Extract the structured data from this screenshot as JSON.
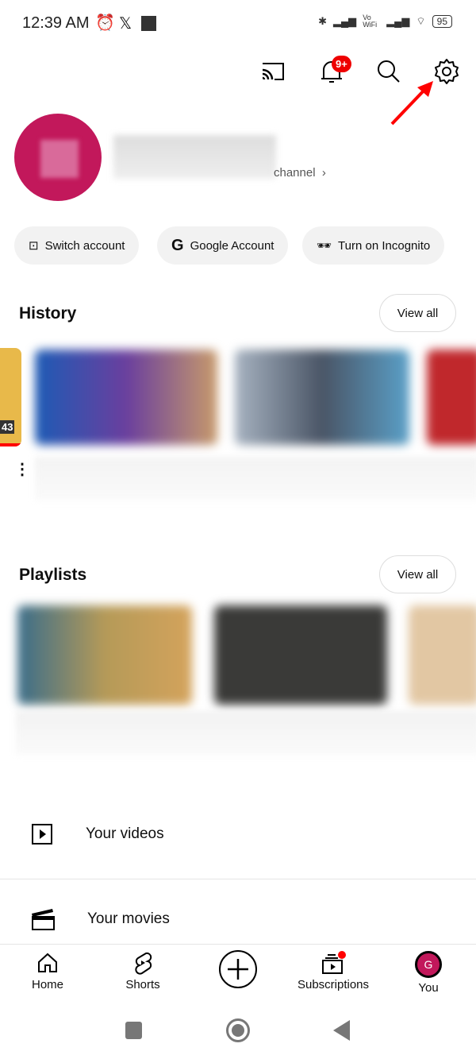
{
  "status_bar": {
    "time": "12:39 AM",
    "battery": "95",
    "network": "Vo WiFi"
  },
  "header": {
    "notification_count": "9+",
    "icons": [
      "cast-icon",
      "bell-icon",
      "search-icon",
      "gear-icon"
    ]
  },
  "profile": {
    "channel_link": "channel"
  },
  "chips": [
    {
      "label": "Switch account",
      "icon": "switch-account-icon"
    },
    {
      "label": "Google Account",
      "icon": "google-icon"
    },
    {
      "label": "Turn on Incognito",
      "icon": "incognito-icon"
    }
  ],
  "history": {
    "title": "History",
    "view_all": "View all",
    "progress_label": "43"
  },
  "playlists": {
    "title": "Playlists",
    "view_all": "View all"
  },
  "list": [
    {
      "label": "Your videos",
      "icon": "play-square-icon"
    },
    {
      "label": "Your movies",
      "icon": "clapperboard-icon"
    }
  ],
  "nav": [
    {
      "label": "Home"
    },
    {
      "label": "Shorts"
    },
    {
      "label": "Create"
    },
    {
      "label": "Subscriptions"
    },
    {
      "label": "You",
      "avatar_letter": "G"
    }
  ],
  "colors": {
    "accent": "#ff0000",
    "avatar": "#c2185b"
  }
}
